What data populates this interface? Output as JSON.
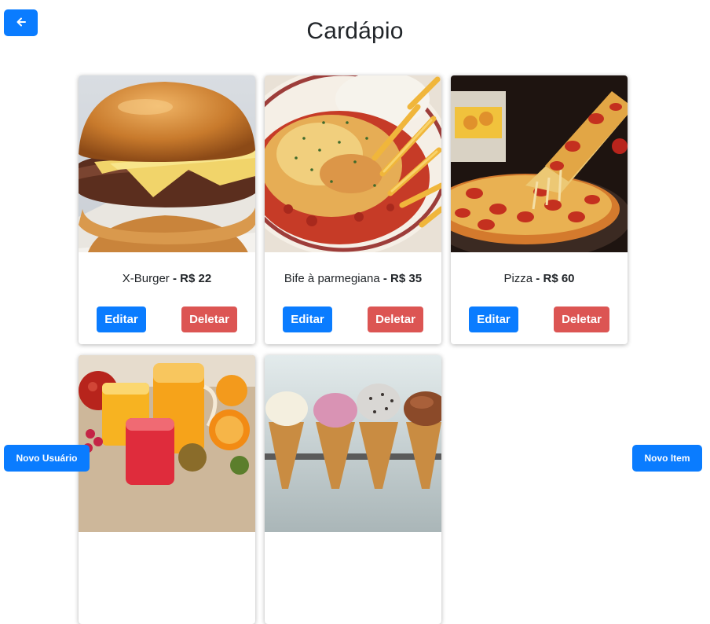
{
  "header": {
    "title": "Cardápio"
  },
  "currency_label": "R$",
  "items": [
    {
      "name": "X-Burger",
      "price": "22",
      "image": "burger-photo"
    },
    {
      "name": "Bife à parmegiana",
      "price": "35",
      "image": "parmigiana-photo"
    },
    {
      "name": "Pizza",
      "price": "60",
      "image": "pizza-photo"
    },
    {
      "name": "",
      "price": "",
      "image": "juice-photo"
    },
    {
      "name": "",
      "price": "",
      "image": "ice-cream-photo"
    }
  ],
  "buttons": {
    "edit": "Editar",
    "delete": "Deletar",
    "new_user": "Novo Usuário",
    "new_item": "Novo Item"
  },
  "icons": {
    "back": "arrow-left-icon"
  },
  "colors": {
    "primary": "#0a7cff",
    "danger": "#dc5553"
  }
}
